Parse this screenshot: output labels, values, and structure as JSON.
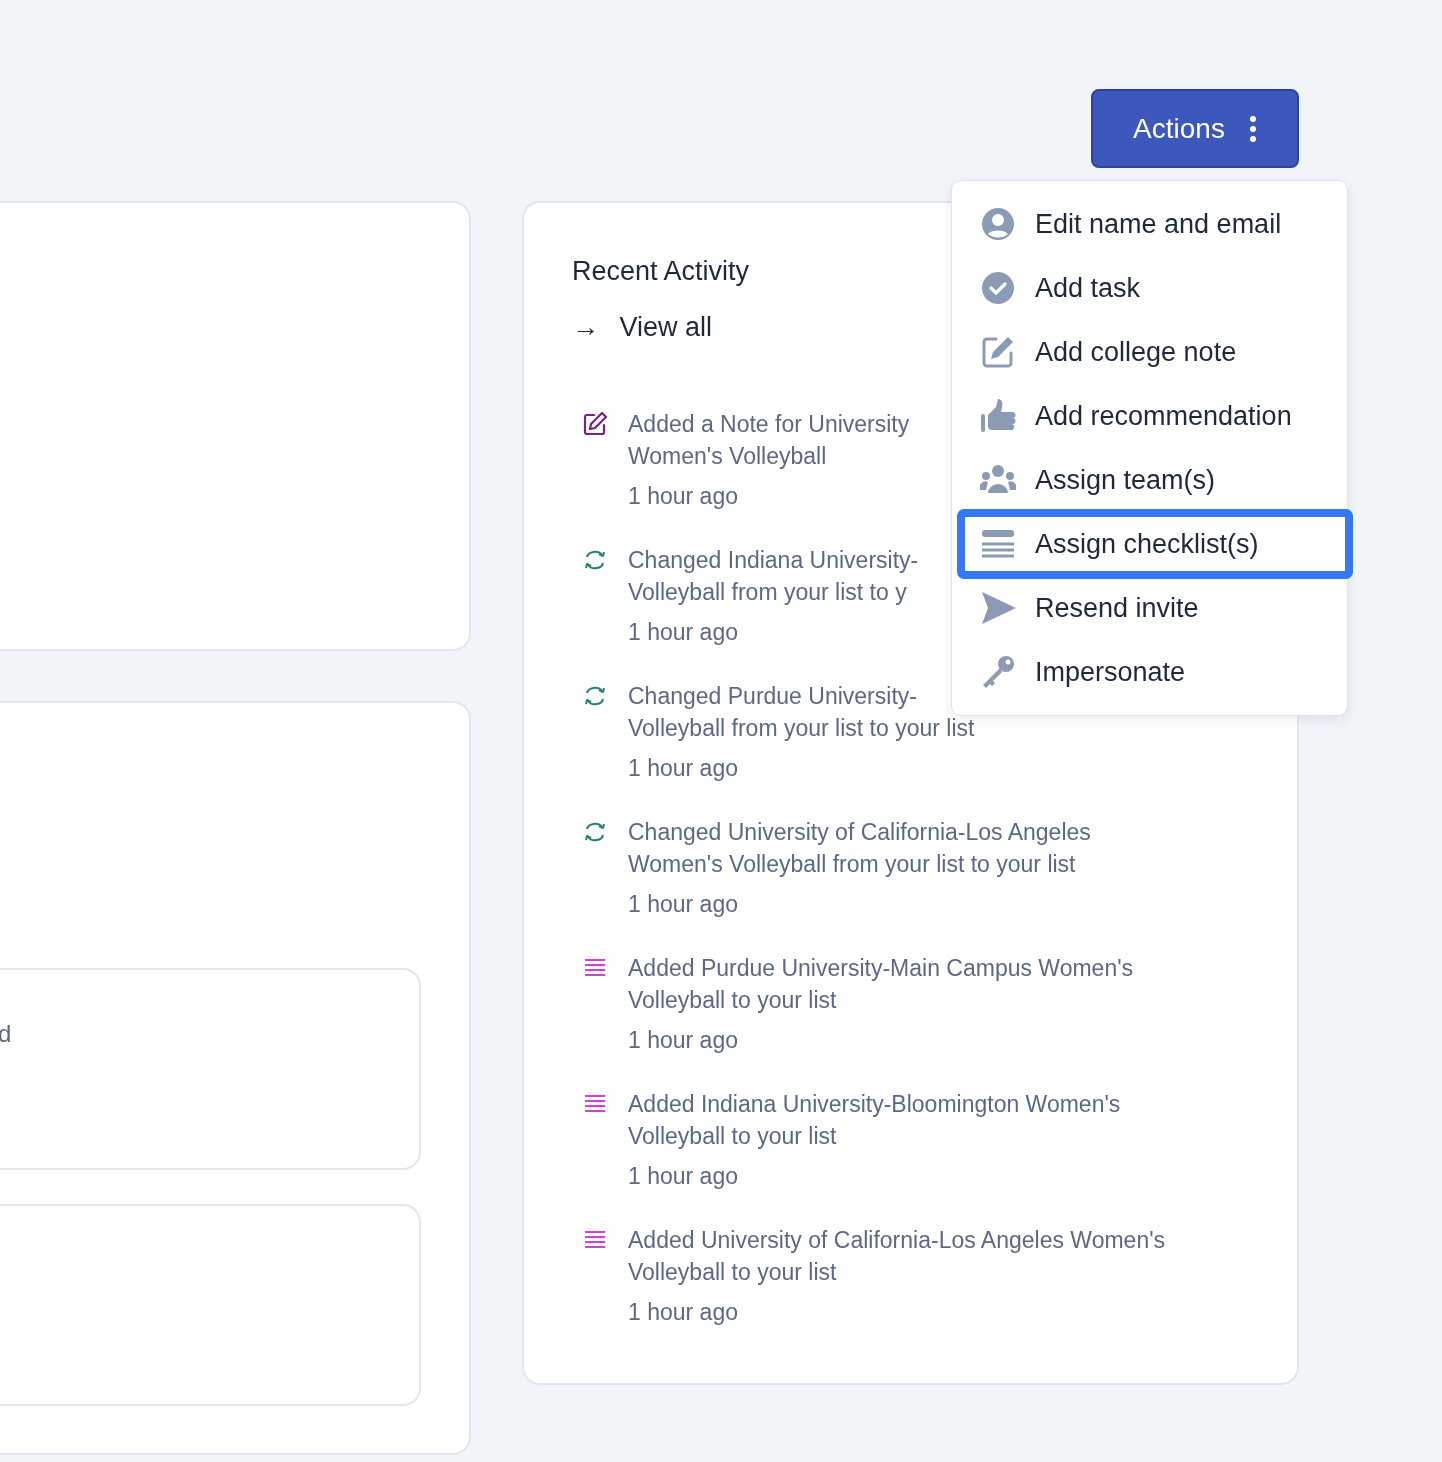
{
  "actions_button": {
    "label": "Actions"
  },
  "left_panel": {
    "fragment": "d"
  },
  "recent_activity": {
    "title": "Recent Activity",
    "view_all": {
      "arrow": "→",
      "label": "View all"
    },
    "items": [
      {
        "kind": "note",
        "text": "Added a Note for University\nWomen's Volleyball",
        "time": "1 hour ago"
      },
      {
        "kind": "change",
        "text": "Changed Indiana University-\nVolleyball from your list to y",
        "time": "1 hour ago"
      },
      {
        "kind": "change",
        "text": "Changed Purdue University-\nVolleyball from your list to your list",
        "time": "1 hour ago"
      },
      {
        "kind": "change",
        "text": "Changed University of California-Los Angeles\nWomen's Volleyball from your list to your list",
        "time": "1 hour ago"
      },
      {
        "kind": "list",
        "text": "Added Purdue University-Main Campus Women's\nVolleyball to your list",
        "time": "1 hour ago"
      },
      {
        "kind": "list",
        "text": "Added Indiana University-Bloomington Women's\nVolleyball to your list",
        "time": "1 hour ago"
      },
      {
        "kind": "list",
        "text": "Added University of California-Los Angeles Women's\nVolleyball to your list",
        "time": "1 hour ago"
      }
    ]
  },
  "actions_menu": {
    "items": [
      {
        "kind": "user",
        "label": "Edit name and email",
        "selected": false
      },
      {
        "kind": "task",
        "label": "Add task",
        "selected": false
      },
      {
        "kind": "note",
        "label": "Add college note",
        "selected": false
      },
      {
        "kind": "recommend",
        "label": "Add recommendation",
        "selected": false
      },
      {
        "kind": "team",
        "label": "Assign team(s)",
        "selected": false
      },
      {
        "kind": "checklist",
        "label": "Assign checklist(s)",
        "selected": true
      },
      {
        "kind": "invite",
        "label": "Resend invite",
        "selected": false
      },
      {
        "kind": "impersonate",
        "label": "Impersonate",
        "selected": false
      }
    ]
  }
}
